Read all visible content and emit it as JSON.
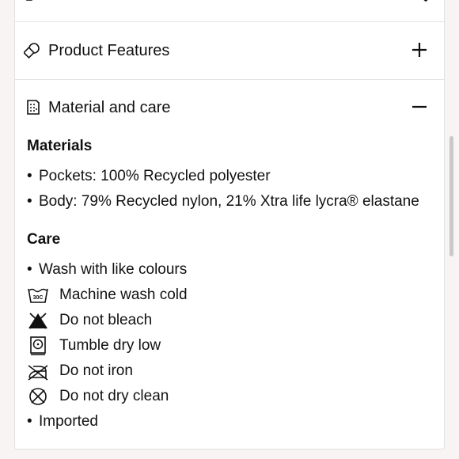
{
  "accordion": {
    "features": {
      "label": "Product Features",
      "icon": "shapes-icon",
      "toggle": "plus"
    },
    "material": {
      "label": "Material and care",
      "icon": "fabric-icon",
      "toggle": "minus"
    }
  },
  "materials": {
    "title": "Materials",
    "items": [
      "Pockets: 100% Recycled polyester",
      "Body: 79% Recycled nylon, 21% Xtra life lycra® elastane"
    ]
  },
  "care": {
    "title": "Care",
    "bullet_first": "Wash with like colours",
    "icons": [
      {
        "label": "Machine wash cold",
        "icon": "wash-30c-icon",
        "icon_text": "30C"
      },
      {
        "label": "Do not bleach",
        "icon": "no-bleach-icon"
      },
      {
        "label": "Tumble dry low",
        "icon": "tumble-dry-low-icon"
      },
      {
        "label": "Do not iron",
        "icon": "no-iron-icon"
      },
      {
        "label": "Do not dry clean",
        "icon": "no-dry-clean-icon"
      }
    ],
    "bullet_last": "Imported"
  }
}
